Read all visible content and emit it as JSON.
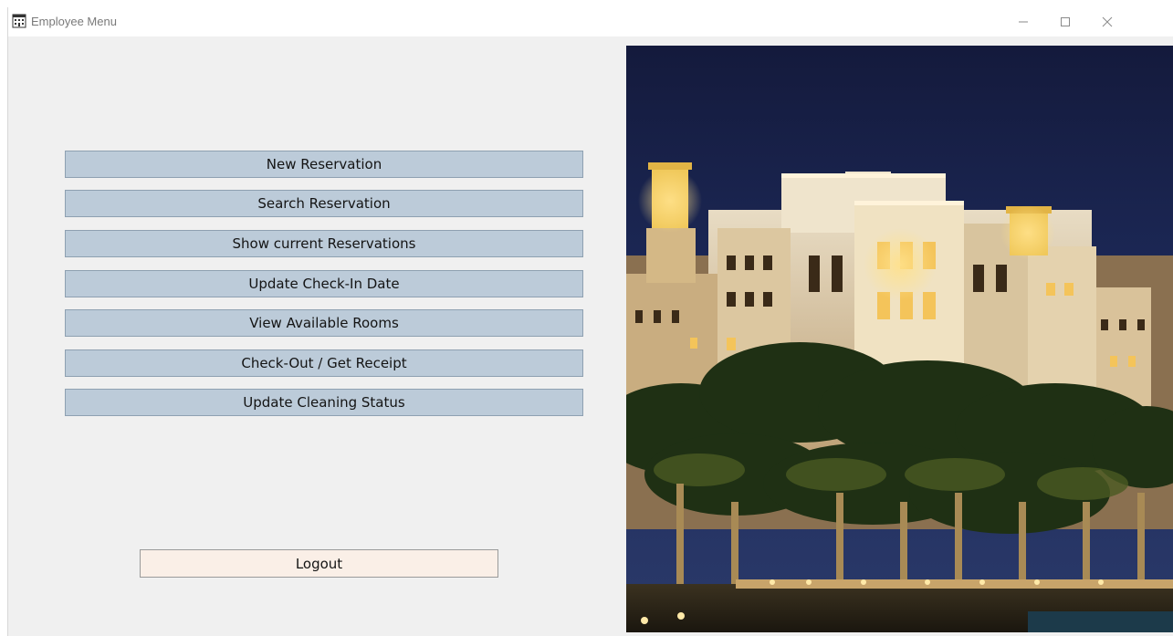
{
  "window": {
    "title": "Employee Menu",
    "icon": "hotel-building-icon",
    "controls": [
      "minimize-icon",
      "maximize-icon",
      "close-icon"
    ]
  },
  "menu": {
    "buttons": [
      {
        "label": "New Reservation"
      },
      {
        "label": "Search Reservation"
      },
      {
        "label": "Show current Reservations"
      },
      {
        "label": "Update Check-In Date"
      },
      {
        "label": "View Available Rooms"
      },
      {
        "label": "Check-Out / Get Receipt"
      },
      {
        "label": "Update Cleaning Status"
      }
    ],
    "logout_label": "Logout"
  },
  "image": {
    "subject": "hotel-at-night-photo"
  },
  "colors": {
    "button_bg": "#bccbd9",
    "logout_bg": "#faefe7",
    "window_bg": "#f0f0f0"
  }
}
